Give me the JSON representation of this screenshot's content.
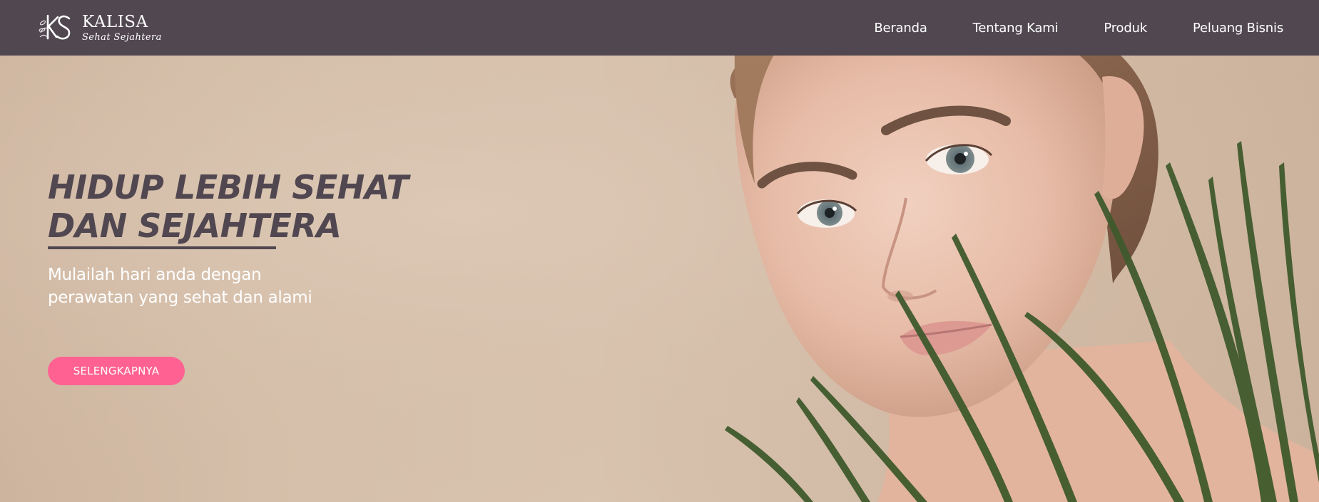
{
  "brand": {
    "name": "KALISA",
    "tagline": "Sehat Sejahtera",
    "monogram": "KS"
  },
  "nav": {
    "items": [
      {
        "label": "Beranda"
      },
      {
        "label": "Tentang Kami"
      },
      {
        "label": "Produk"
      },
      {
        "label": "Peluang Bisnis"
      }
    ]
  },
  "hero": {
    "title_line1": "HIDUP LEBIH SEHAT",
    "title_line2": "DAN SEJAHTERA",
    "subtitle_line1": "Mulailah hari anda dengan",
    "subtitle_line2": "perawatan yang sehat dan alami",
    "cta_label": "SELENGKAPNYA"
  },
  "colors": {
    "header_bg": "#514750",
    "title": "#514750",
    "cta_bg": "#ff6192",
    "hero_bg": "#d6c0ab"
  }
}
